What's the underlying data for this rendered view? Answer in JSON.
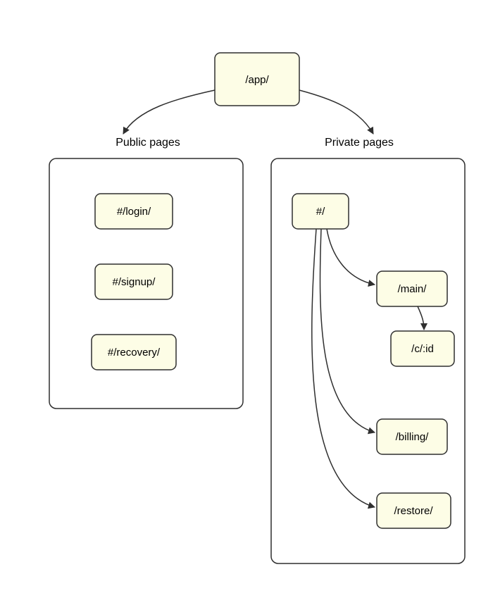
{
  "root": {
    "label": "/app/"
  },
  "sections": {
    "public": {
      "title": "Public pages"
    },
    "private": {
      "title": "Private pages"
    }
  },
  "public_pages": {
    "login": {
      "label": "#/login/"
    },
    "signup": {
      "label": "#/signup/"
    },
    "recovery": {
      "label": "#/recovery/"
    }
  },
  "private_pages": {
    "root": {
      "label": "#/"
    },
    "main": {
      "label": "/main/"
    },
    "c_id": {
      "label": "/c/:id"
    },
    "billing": {
      "label": "/billing/"
    },
    "restore": {
      "label": "/restore/"
    }
  },
  "edges": [
    {
      "from": "root",
      "to": "public-group"
    },
    {
      "from": "root",
      "to": "private-group"
    },
    {
      "from": "private.root",
      "to": "private.main"
    },
    {
      "from": "private.main",
      "to": "private.c_id"
    },
    {
      "from": "private.root",
      "to": "private.billing"
    },
    {
      "from": "private.root",
      "to": "private.restore"
    }
  ]
}
